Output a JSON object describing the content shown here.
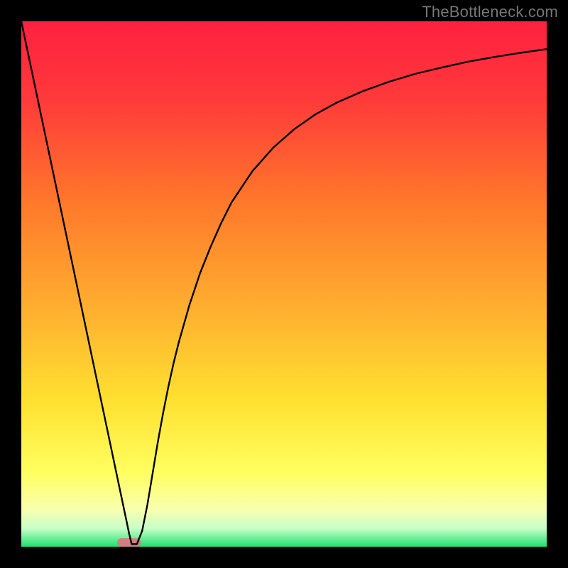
{
  "attribution": "TheBottleneck.com",
  "chart_data": {
    "type": "line",
    "title": "",
    "xlabel": "",
    "ylabel": "",
    "xlim": [
      0,
      100
    ],
    "ylim": [
      0,
      100
    ],
    "background_gradient": {
      "stops": [
        {
          "pos": 0.0,
          "color": "#ff2040"
        },
        {
          "pos": 0.15,
          "color": "#ff3a3a"
        },
        {
          "pos": 0.35,
          "color": "#ff7a2a"
        },
        {
          "pos": 0.55,
          "color": "#ffb030"
        },
        {
          "pos": 0.72,
          "color": "#ffe030"
        },
        {
          "pos": 0.86,
          "color": "#ffff60"
        },
        {
          "pos": 0.93,
          "color": "#f8ffb0"
        },
        {
          "pos": 0.965,
          "color": "#c8ffc8"
        },
        {
          "pos": 1.0,
          "color": "#20e070"
        }
      ]
    },
    "series": [
      {
        "name": "bottleneck-curve",
        "color": "#000000",
        "x": [
          0,
          2,
          4,
          6,
          8,
          10,
          12,
          14,
          16,
          17,
          18,
          19,
          20,
          20.5,
          21,
          22,
          23,
          24,
          25,
          26,
          27,
          28,
          29,
          30,
          32,
          34,
          36,
          38,
          40,
          44,
          48,
          52,
          56,
          60,
          65,
          70,
          75,
          80,
          85,
          90,
          95,
          100
        ],
        "y": [
          100,
          90.5,
          81,
          71.5,
          62,
          52.5,
          43,
          33.5,
          24,
          19.25,
          14.5,
          9.75,
          5,
          2.6,
          0.5,
          0.5,
          3,
          8,
          14,
          20,
          25.5,
          30.5,
          35,
          39,
          46,
          52,
          57,
          61.5,
          65.5,
          71.5,
          76,
          79.5,
          82.3,
          84.5,
          86.7,
          88.5,
          90,
          91.2,
          92.3,
          93.2,
          94,
          94.7
        ]
      }
    ],
    "marker": {
      "x": 20.5,
      "y": 0.8,
      "width": 4.5,
      "height": 1.6,
      "color": "#d08080"
    }
  }
}
